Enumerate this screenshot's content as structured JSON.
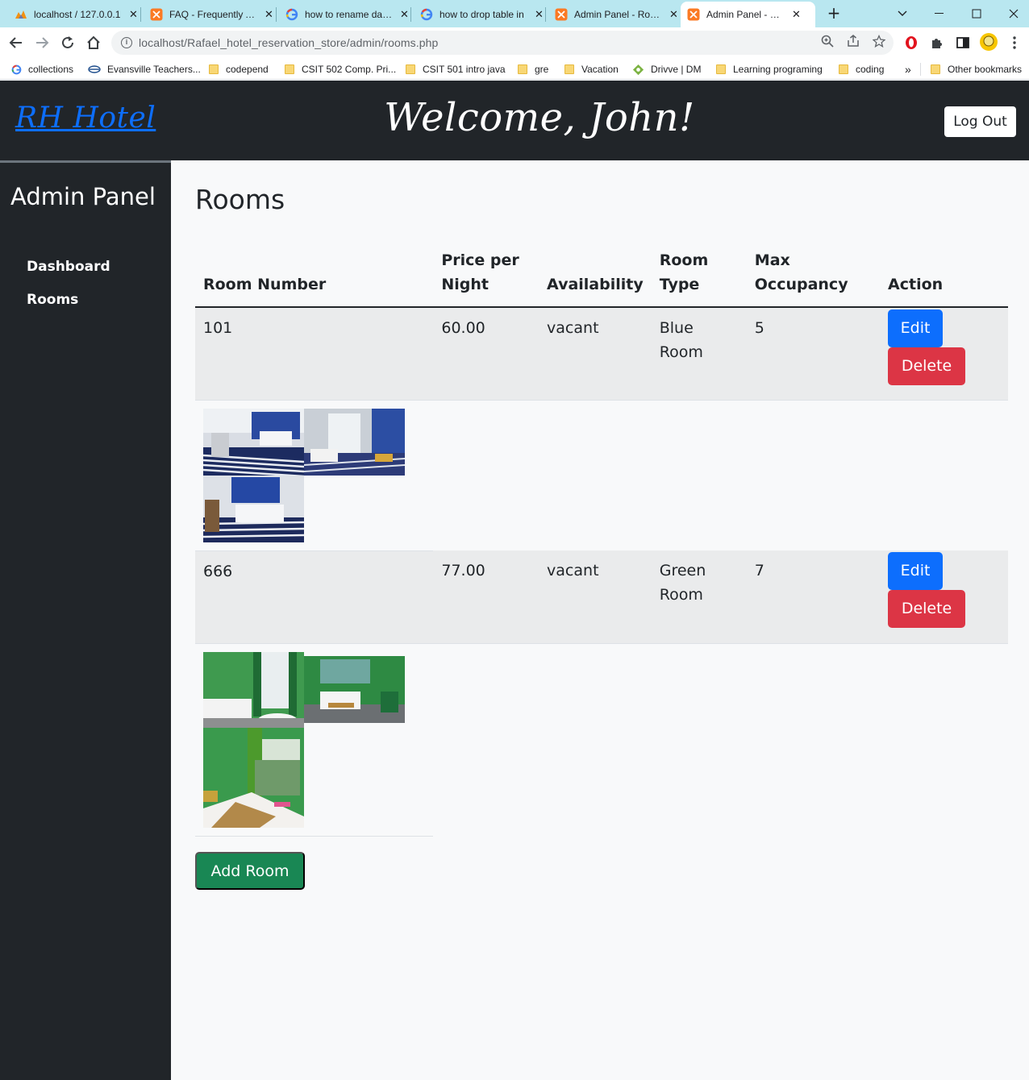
{
  "browser": {
    "tabs": [
      {
        "title": "localhost / 127.0.0.1",
        "icon": "phpmyadmin-icon",
        "active": false
      },
      {
        "title": "FAQ - Frequently Asked",
        "icon": "xampp-icon",
        "active": false
      },
      {
        "title": "how to rename database",
        "icon": "google-icon",
        "active": false
      },
      {
        "title": "how to drop table in",
        "icon": "google-icon",
        "active": false
      },
      {
        "title": "Admin Panel - Rooms",
        "icon": "xampp-icon",
        "active": false
      },
      {
        "title": "Admin Panel - Rooms",
        "icon": "xampp-icon",
        "active": true
      }
    ],
    "url": "localhost/Rafael_hotel_reservation_store/admin/rooms.php",
    "bookmarks": [
      {
        "label": "collections",
        "icon": "google-icon"
      },
      {
        "label": "Evansville Teachers...",
        "icon": "link-icon"
      },
      {
        "label": "codepend",
        "icon": "folder-icon"
      },
      {
        "label": "CSIT 502 Comp. Pri...",
        "icon": "folder-icon"
      },
      {
        "label": "CSIT 501 intro java",
        "icon": "folder-icon"
      },
      {
        "label": "gre",
        "icon": "folder-icon"
      },
      {
        "label": "Vacation",
        "icon": "folder-icon"
      },
      {
        "label": "Drivve | DM",
        "icon": "drivve-icon"
      },
      {
        "label": "Learning programing",
        "icon": "folder-icon"
      },
      {
        "label": "coding",
        "icon": "folder-icon"
      }
    ],
    "overflow_label": "»",
    "other_bookmarks": "Other bookmarks"
  },
  "header": {
    "brand": "RH Hotel",
    "welcome": "Welcome, John!",
    "logout": "Log Out"
  },
  "sidebar": {
    "title": "Admin Panel",
    "items": [
      {
        "label": "Dashboard"
      },
      {
        "label": "Rooms"
      }
    ]
  },
  "main": {
    "title": "Rooms",
    "columns": [
      "Room Number",
      "Price per Night",
      "Availability",
      "Room Type",
      "Max Occupancy",
      "Action"
    ],
    "rooms": [
      {
        "number": "101",
        "price": "60.00",
        "availability": "vacant",
        "type": "Blue Room",
        "occupancy": "5",
        "theme": "blue"
      },
      {
        "number": "666",
        "price": "77.00",
        "availability": "vacant",
        "type": "Green Room",
        "occupancy": "7",
        "theme": "green"
      }
    ],
    "edit_label": "Edit",
    "delete_label": "Delete",
    "add_room": "Add Room"
  },
  "colors": {
    "header_bg": "#212529",
    "brand_link": "#0d6efd",
    "edit": "#0d6efd",
    "delete": "#dc3545",
    "add": "#198754"
  }
}
